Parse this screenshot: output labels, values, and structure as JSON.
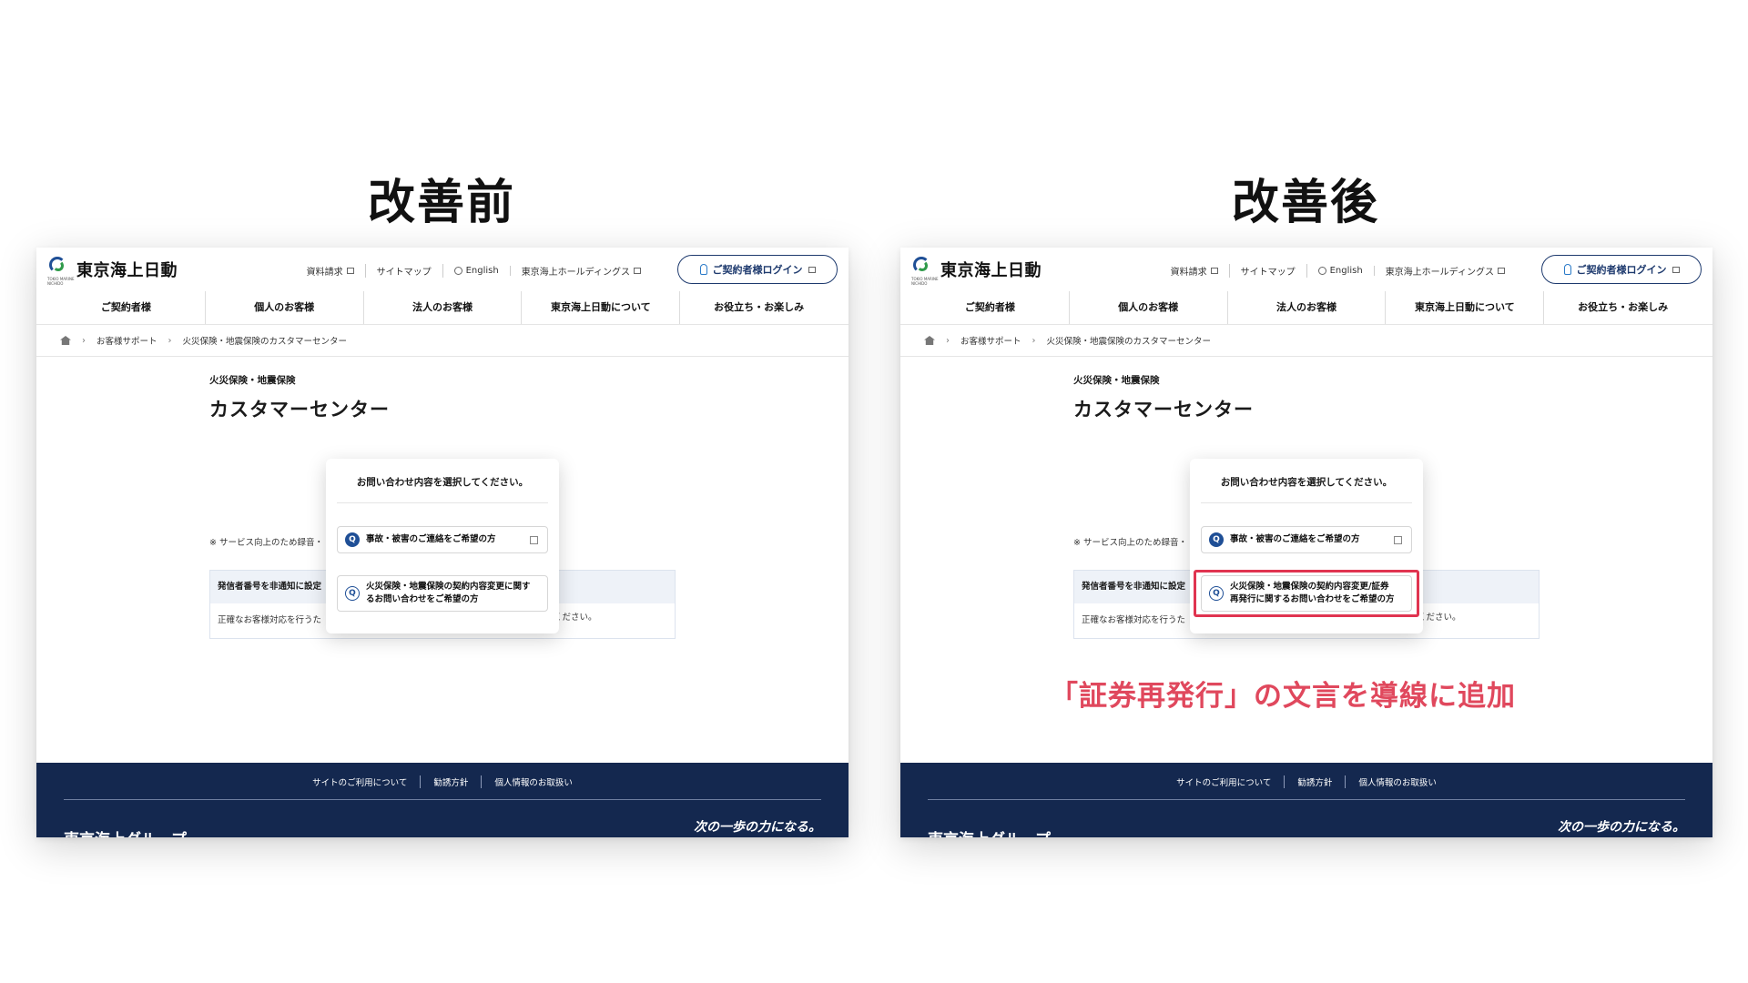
{
  "headings": {
    "before": "改善前",
    "after": "改善後"
  },
  "site": {
    "logo_text": "東京海上日動",
    "logo_sub": "TOKIO MARINE NICHIDO",
    "util_links": [
      "資料請求",
      "サイトマップ",
      "English",
      "東京海上ホールディングス"
    ],
    "login_label": "ご契約者様ログイン",
    "nav": [
      "ご契約者様",
      "個人のお客様",
      "法人のお客様",
      "東京海上日動について",
      "お役立ち・お楽しみ"
    ],
    "breadcrumb": [
      "お客様サポート",
      "火災保険・地震保険のカスタマーセンター"
    ],
    "eyebrow": "火災保険・地震保険",
    "title": "カスタマーセンター",
    "notice_text": "※ サービス向上のため録音・",
    "notice_head": "発信者番号を非通知に設定",
    "notice_body": "正確なお客様対応を行うた",
    "notice_tail": "ください。",
    "modal_title": "お問い合わせ内容を選択してください。",
    "option1": "事故・被害のご連絡をご希望の方",
    "option2_before": "火災保険・地震保険の契約内容変更に関す\nるお問い合わせをご希望の方",
    "option2_after": "火災保険・地震保険の契約内容変更/証券\n再発行に関するお問い合わせをご希望の方",
    "footer_links": [
      "サイトのご利用について",
      "勧誘方針",
      "個人情報のお取扱い"
    ],
    "footer_brand": "東京海上グループ",
    "footer_slogan": "次の一歩の力になる。"
  },
  "annotation": "「証券再発行」の文言を導線に追加",
  "colors": {
    "navy": "#14284f",
    "accent_red": "#e0485d",
    "brand_blue": "#1f4f96"
  }
}
